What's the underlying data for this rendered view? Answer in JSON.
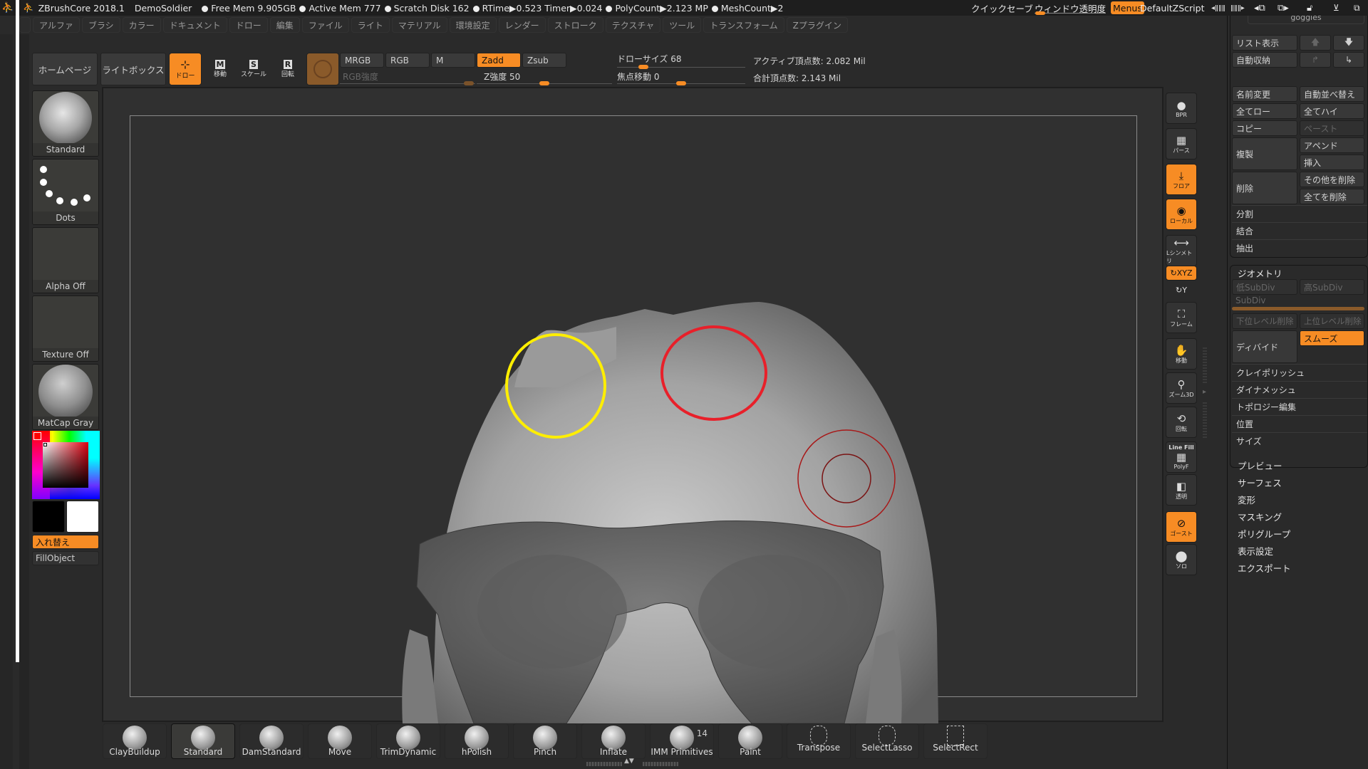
{
  "titlebar": {
    "app": "ZBrushCore 2018.1",
    "project": "DemoSoldier",
    "stats": [
      "Free Mem 9.905GB",
      "Active Mem 777",
      "Scratch Disk 162",
      "RTime▶0.523 Timer▶0.024",
      "PolyCount▶2.123 MP",
      "MeshCount▶2"
    ],
    "quicksave": "クイックセーブ",
    "transparency": "ウィンドウ透明度",
    "menus": "Menus",
    "script": "DefaultZScript"
  },
  "menubar": [
    "アルファ",
    "ブラシ",
    "カラー",
    "ドキュメント",
    "ドロー",
    "編集",
    "ファイル",
    "ライト",
    "マテリアル",
    "環境設定",
    "レンダー",
    "ストローク",
    "テクスチャ",
    "ツール",
    "トランスフォーム",
    "Zプラグイン"
  ],
  "topshelf": {
    "home": "ホームページ",
    "lightbox": "ライトボックス",
    "draw": "ドロー",
    "move": "移動",
    "scale": "スケール",
    "rotate": "回転",
    "mrgb": "MRGB",
    "rgb": "RGB",
    "m": "M",
    "rgb_intensity": "RGB強度",
    "zadd": "Zadd",
    "zsub": "Zsub",
    "z_intensity_label": "Z強度 50",
    "z_intensity": 50,
    "draw_size_label": "ドローサイズ 68",
    "draw_size": 68,
    "focal_shift_label": "焦点移動 0",
    "focal_shift": 0,
    "active_points": "アクティブ頂点数: 2.082 Mil",
    "total_points": "合計頂点数: 2.143 Mil"
  },
  "leftshelf": {
    "brush": "Standard",
    "stroke": "Dots",
    "alpha": "Alpha Off",
    "texture": "Texture Off",
    "material": "MatCap Gray",
    "swap": "入れ替え",
    "fill": "FillObject",
    "main_color": "#ff0000",
    "secondary_color": "#000000",
    "tertiary_color": "#ffffff"
  },
  "rightshelf": [
    {
      "name": "bpr",
      "label": "BPR",
      "active": false
    },
    {
      "name": "perspective",
      "label": "パース",
      "active": false
    },
    {
      "name": "floor",
      "label": "フロア",
      "active": true
    },
    {
      "name": "local",
      "label": "ローカル",
      "active": true
    },
    {
      "name": "lsym",
      "label": "Lシンメトリ",
      "active": false
    },
    {
      "name": "xyz",
      "label": "XYZ",
      "active": true
    },
    {
      "name": "y",
      "label": "Y",
      "active": false
    },
    {
      "name": "frame",
      "label": "フレーム",
      "active": false
    },
    {
      "name": "move",
      "label": "移動",
      "active": false
    },
    {
      "name": "zoom3d",
      "label": "ズーム3D",
      "active": false
    },
    {
      "name": "rotate",
      "label": "回転",
      "active": false
    },
    {
      "name": "polyf",
      "label": "PolyF",
      "top": "Line Fill",
      "active": false
    },
    {
      "name": "transp",
      "label": "透明",
      "active": false
    },
    {
      "name": "ghost",
      "label": "ゴースト",
      "active": true
    },
    {
      "name": "solo",
      "label": "ソロ",
      "active": false
    }
  ],
  "tray": {
    "subtool_name": "goggles",
    "list_view": "リスト表示",
    "auto_collapse": "自動収納",
    "rename": "名前変更",
    "auto_reorder": "自動並べ替え",
    "all_low": "全てロー",
    "all_high": "全てハイ",
    "copy": "コピー",
    "paste": "ペースト",
    "duplicate": "複製",
    "append": "アペンド",
    "insert": "挿入",
    "delete": "削除",
    "delete_other": "その他を削除",
    "delete_all": "全てを削除",
    "split": "分割",
    "merge": "結合",
    "extract": "抽出",
    "geometry": {
      "title": "ジオメトリ",
      "lower_subdiv": "低SubDiv",
      "higher_subdiv": "高SubDiv",
      "subdiv": "SubDiv",
      "del_lower": "下位レベル削除",
      "del_higher": "上位レベル削除",
      "divide": "ディバイド",
      "smooth": "スムーズ",
      "items": [
        "クレイポリッシュ",
        "ダイナメッシュ",
        "トポロジー編集",
        "位置",
        "サイズ"
      ]
    },
    "sections": [
      "プレビュー",
      "サーフェス",
      "変形",
      "マスキング",
      "ポリグループ",
      "表示設定",
      "エクスポート"
    ]
  },
  "brushbar": [
    {
      "label": "ClayBuildup"
    },
    {
      "label": "Standard",
      "selected": true
    },
    {
      "label": "DamStandard"
    },
    {
      "label": "Move"
    },
    {
      "label": "TrimDynamic"
    },
    {
      "label": "hPolish"
    },
    {
      "label": "Pinch"
    },
    {
      "label": "Inflate"
    },
    {
      "label": "IMM Primitives",
      "count": "14"
    },
    {
      "label": "Paint"
    },
    {
      "label": "Transpose"
    },
    {
      "label": "SelectLasso"
    },
    {
      "label": "SelectRect"
    }
  ],
  "colors": {
    "accent": "#f78c24",
    "highlight_yellow": "#ffee00",
    "highlight_red": "#e8202a"
  }
}
